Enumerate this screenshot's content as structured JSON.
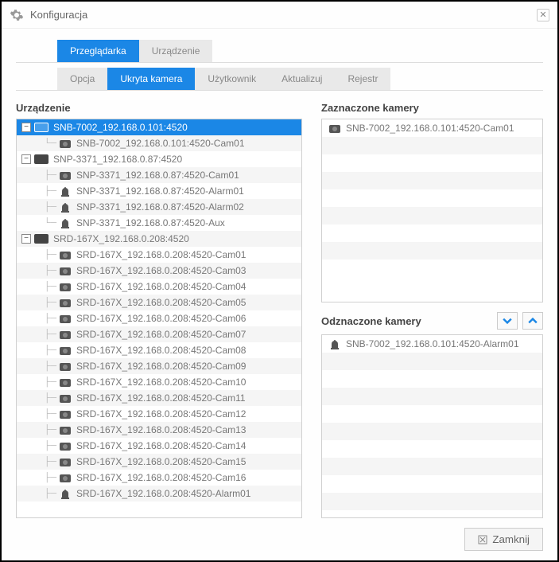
{
  "window": {
    "title": "Konfiguracja"
  },
  "tabsTop": [
    {
      "label": "Przeglądarka",
      "active": true
    },
    {
      "label": "Urządzenie",
      "active": false
    }
  ],
  "tabsSub": [
    {
      "label": "Opcja",
      "active": false
    },
    {
      "label": "Ukryta kamera",
      "active": true
    },
    {
      "label": "Użytkownik",
      "active": false
    },
    {
      "label": "Aktualizuj",
      "active": false
    },
    {
      "label": "Rejestr",
      "active": false
    }
  ],
  "labels": {
    "deviceSection": "Urządzenie",
    "checkedSection": "Zaznaczone kamery",
    "uncheckedSection": "Odznaczone kamery",
    "close": "Zamknij"
  },
  "tree": [
    {
      "kind": "device",
      "label": "SNB-7002_192.168.0.101:4520",
      "selected": true
    },
    {
      "kind": "cam",
      "label": "SNB-7002_192.168.0.101:4520-Cam01",
      "last": true
    },
    {
      "kind": "device",
      "label": "SNP-3371_192.168.0.87:4520"
    },
    {
      "kind": "cam",
      "label": "SNP-3371_192.168.0.87:4520-Cam01"
    },
    {
      "kind": "alarm",
      "label": "SNP-3371_192.168.0.87:4520-Alarm01"
    },
    {
      "kind": "alarm",
      "label": "SNP-3371_192.168.0.87:4520-Alarm02"
    },
    {
      "kind": "alarm",
      "label": "SNP-3371_192.168.0.87:4520-Aux",
      "last": true
    },
    {
      "kind": "device",
      "label": "SRD-167X_192.168.0.208:4520"
    },
    {
      "kind": "cam",
      "label": "SRD-167X_192.168.0.208:4520-Cam01"
    },
    {
      "kind": "cam",
      "label": "SRD-167X_192.168.0.208:4520-Cam03"
    },
    {
      "kind": "cam",
      "label": "SRD-167X_192.168.0.208:4520-Cam04"
    },
    {
      "kind": "cam",
      "label": "SRD-167X_192.168.0.208:4520-Cam05"
    },
    {
      "kind": "cam",
      "label": "SRD-167X_192.168.0.208:4520-Cam06"
    },
    {
      "kind": "cam",
      "label": "SRD-167X_192.168.0.208:4520-Cam07"
    },
    {
      "kind": "cam",
      "label": "SRD-167X_192.168.0.208:4520-Cam08"
    },
    {
      "kind": "cam",
      "label": "SRD-167X_192.168.0.208:4520-Cam09"
    },
    {
      "kind": "cam",
      "label": "SRD-167X_192.168.0.208:4520-Cam10"
    },
    {
      "kind": "cam",
      "label": "SRD-167X_192.168.0.208:4520-Cam11"
    },
    {
      "kind": "cam",
      "label": "SRD-167X_192.168.0.208:4520-Cam12"
    },
    {
      "kind": "cam",
      "label": "SRD-167X_192.168.0.208:4520-Cam13"
    },
    {
      "kind": "cam",
      "label": "SRD-167X_192.168.0.208:4520-Cam14"
    },
    {
      "kind": "cam",
      "label": "SRD-167X_192.168.0.208:4520-Cam15"
    },
    {
      "kind": "cam",
      "label": "SRD-167X_192.168.0.208:4520-Cam16"
    },
    {
      "kind": "alarm",
      "label": "SRD-167X_192.168.0.208:4520-Alarm01"
    }
  ],
  "checked": [
    {
      "kind": "cam",
      "label": "SNB-7002_192.168.0.101:4520-Cam01"
    }
  ],
  "unchecked": [
    {
      "kind": "alarm",
      "label": "SNB-7002_192.168.0.101:4520-Alarm01"
    }
  ]
}
